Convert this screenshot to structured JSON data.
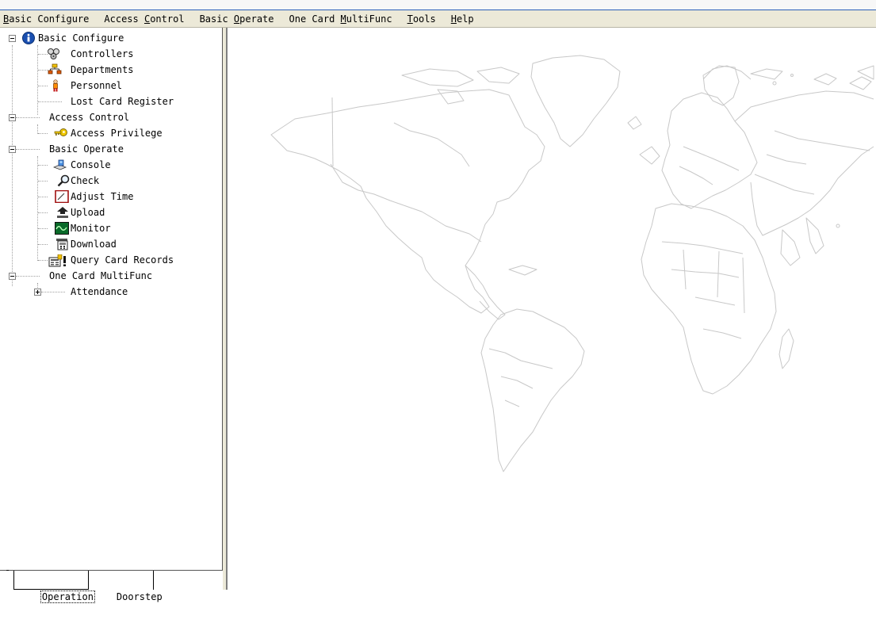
{
  "menu": {
    "items": [
      {
        "pre": "",
        "mn": "B",
        "post": "asic Configure"
      },
      {
        "pre": "Access ",
        "mn": "C",
        "post": "ontrol"
      },
      {
        "pre": "Basic ",
        "mn": "O",
        "post": "perate"
      },
      {
        "pre": "One Card ",
        "mn": "M",
        "post": "ultiFunc"
      },
      {
        "pre": "",
        "mn": "T",
        "post": "ools"
      },
      {
        "pre": "",
        "mn": "H",
        "post": "elp"
      }
    ]
  },
  "tree": {
    "basic_configure": {
      "label": "Basic Configure",
      "controllers": "Controllers",
      "departments": "Departments",
      "personnel": "Personnel",
      "lost_card": "Lost Card Register"
    },
    "access_control": {
      "label": "Access Control",
      "access_privilege": "Access Privilege"
    },
    "basic_operate": {
      "label": "Basic Operate",
      "console": "Console",
      "check": "Check",
      "adjust_time": "Adjust Time",
      "upload": "Upload",
      "monitor": "Monitor",
      "download": "Download",
      "query_card_records": "Query Card Records"
    },
    "one_card": {
      "label": "One Card MultiFunc",
      "attendance": "Attendance"
    }
  },
  "tabs": {
    "dash": "-",
    "operation": "Operation",
    "doorstep": "Doorstep"
  },
  "colors": {
    "menubar_bg": "#ece9d8",
    "map_line": "#c8c8c8"
  }
}
